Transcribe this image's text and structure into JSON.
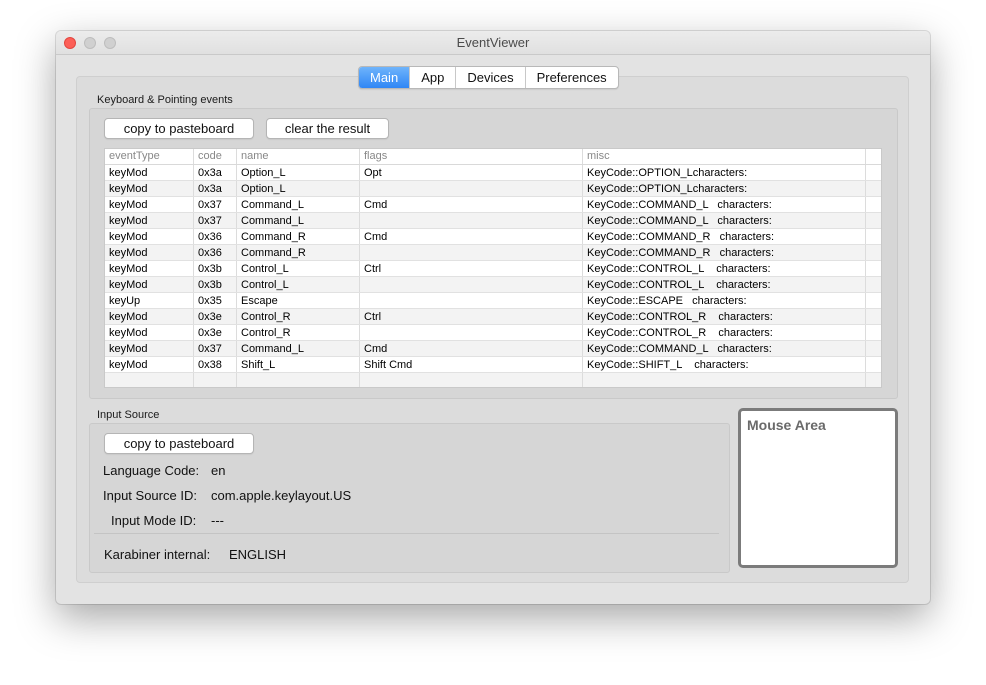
{
  "window": {
    "title": "EventViewer"
  },
  "tabs": [
    {
      "label": "Main",
      "active": true
    },
    {
      "label": "App",
      "active": false
    },
    {
      "label": "Devices",
      "active": false
    },
    {
      "label": "Preferences",
      "active": false
    }
  ],
  "keyboard_events": {
    "group_label": "Keyboard & Pointing events",
    "copy_button": "copy to pasteboard",
    "clear_button": "clear the result",
    "columns": [
      "eventType",
      "code",
      "name",
      "flags",
      "misc"
    ],
    "rows": [
      [
        "keyMod",
        "0x3a",
        "Option_L",
        "Opt",
        "KeyCode::OPTION_Lcharacters:"
      ],
      [
        "keyMod",
        "0x3a",
        "Option_L",
        "",
        "KeyCode::OPTION_Lcharacters:"
      ],
      [
        "keyMod",
        "0x37",
        "Command_L",
        "Cmd",
        "KeyCode::COMMAND_L   characters:"
      ],
      [
        "keyMod",
        "0x37",
        "Command_L",
        "",
        "KeyCode::COMMAND_L   characters:"
      ],
      [
        "keyMod",
        "0x36",
        "Command_R",
        "Cmd",
        "KeyCode::COMMAND_R   characters:"
      ],
      [
        "keyMod",
        "0x36",
        "Command_R",
        "",
        "KeyCode::COMMAND_R   characters:"
      ],
      [
        "keyMod",
        "0x3b",
        "Control_L",
        "Ctrl",
        "KeyCode::CONTROL_L    characters:"
      ],
      [
        "keyMod",
        "0x3b",
        "Control_L",
        "",
        "KeyCode::CONTROL_L    characters:"
      ],
      [
        "keyUp",
        "0x35",
        "Escape",
        "",
        "KeyCode::ESCAPE   characters:"
      ],
      [
        "keyMod",
        "0x3e",
        "Control_R",
        "Ctrl",
        "KeyCode::CONTROL_R    characters:"
      ],
      [
        "keyMod",
        "0x3e",
        "Control_R",
        "",
        "KeyCode::CONTROL_R    characters:"
      ],
      [
        "keyMod",
        "0x37",
        "Command_L",
        "Cmd",
        "KeyCode::COMMAND_L   characters:"
      ],
      [
        "keyMod",
        "0x38",
        "Shift_L",
        "Shift Cmd",
        "KeyCode::SHIFT_L    characters:"
      ]
    ]
  },
  "input_source": {
    "group_label": "Input Source",
    "copy_button": "copy to pasteboard",
    "language_code_label": "Language Code:",
    "language_code_value": "en",
    "input_source_id_label": "Input Source ID:",
    "input_source_id_value": "com.apple.keylayout.US",
    "input_mode_id_label": "Input Mode ID:",
    "input_mode_id_value": "---",
    "karabiner_label": "Karabiner internal:",
    "karabiner_value": "ENGLISH"
  },
  "mouse_area": {
    "label": "Mouse Area"
  }
}
